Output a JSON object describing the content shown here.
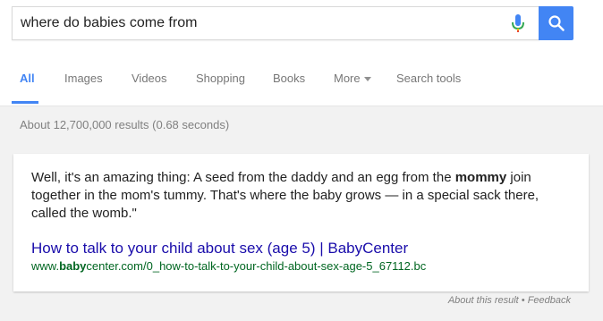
{
  "search": {
    "query": "where do babies come from"
  },
  "tabs": [
    {
      "label": "All"
    },
    {
      "label": "Images"
    },
    {
      "label": "Videos"
    },
    {
      "label": "Shopping"
    },
    {
      "label": "Books"
    },
    {
      "label": "More"
    },
    {
      "label": "Search tools"
    }
  ],
  "results_stats": "About 12,700,000 results (0.68 seconds)",
  "featured_snippet": {
    "text_before_bold": "Well, it's an amazing thing: A seed from the daddy and an egg from the ",
    "bold": "mommy",
    "text_after_bold": " join together in the mom's tummy. That's where the baby grows — in a special sack there, called the womb.\"",
    "link_title": "How to talk to your child about sex (age 5) | BabyCenter",
    "url_prefix": "www.",
    "url_bold": "baby",
    "url_rest": "center.com/0_how-to-talk-to-your-child-about-sex-age-5_67112.bc"
  },
  "footer": {
    "about": "About this result",
    "separator": " • ",
    "feedback": "Feedback"
  },
  "icons": {
    "mic": "microphone-icon",
    "search": "magnifier-icon"
  },
  "colors": {
    "accent": "#4285f4",
    "link": "#1a0dab",
    "url": "#006621"
  }
}
